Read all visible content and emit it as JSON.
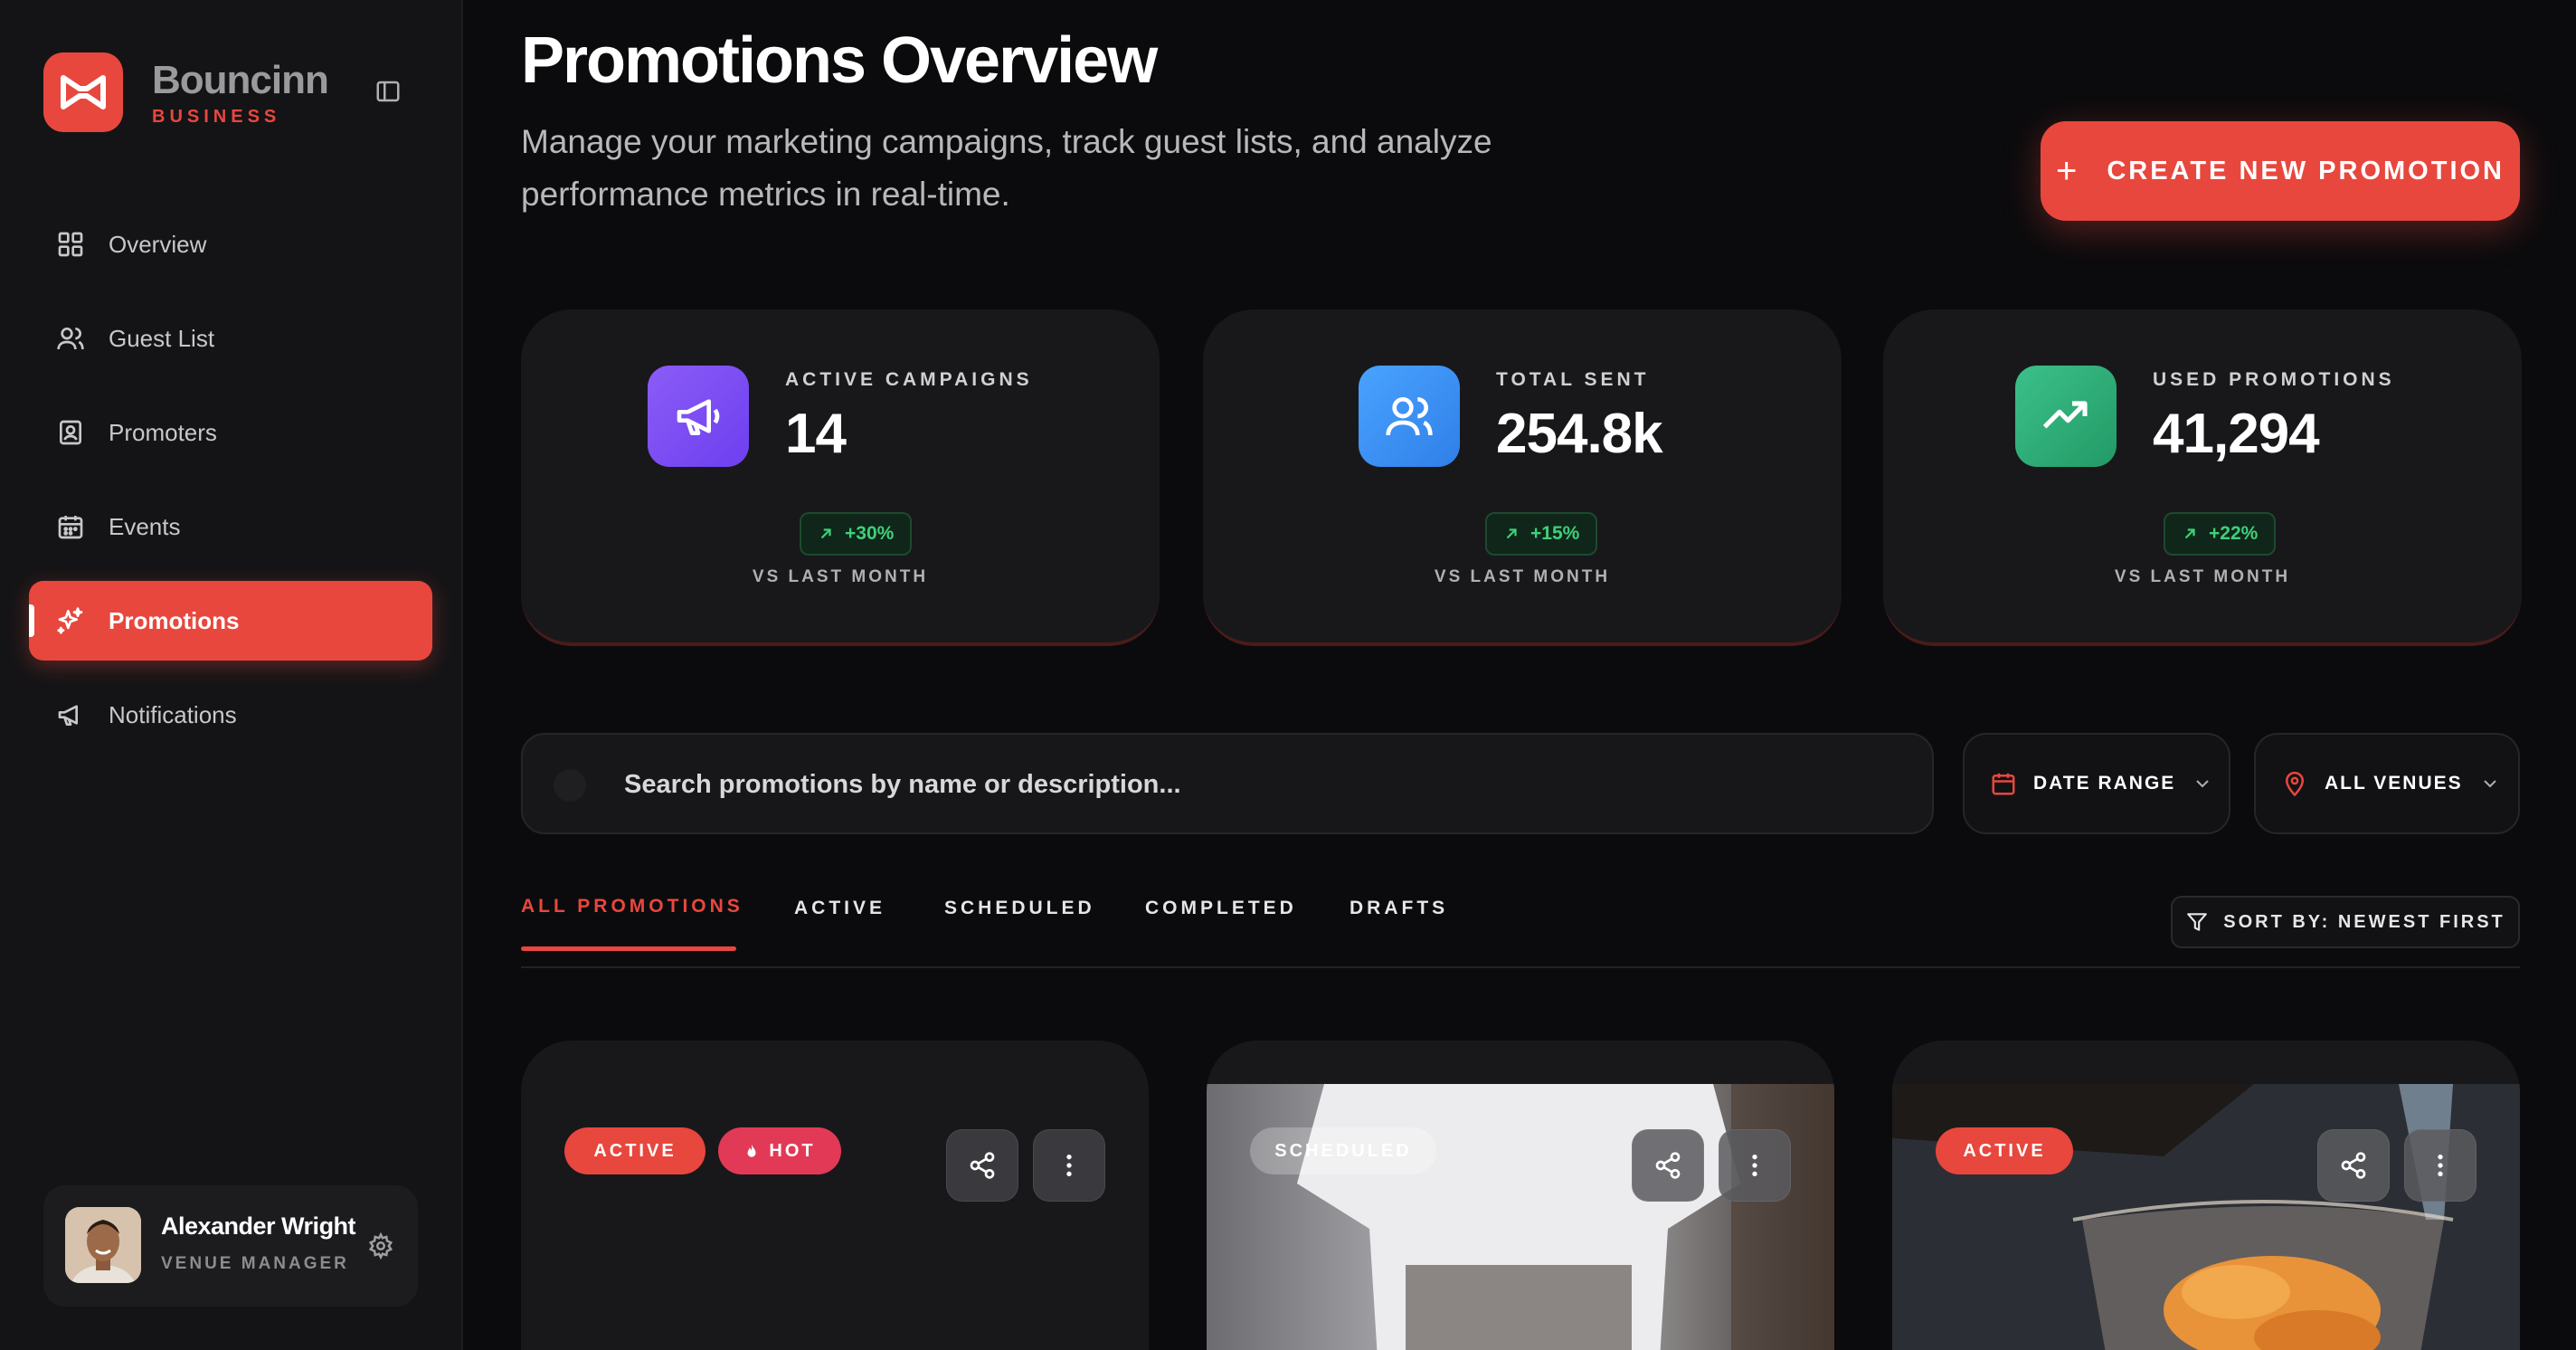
{
  "brand": {
    "name": "Bouncinn",
    "subtitle": "BUSINESS"
  },
  "sidebar": {
    "items": [
      {
        "label": "Overview",
        "icon": "grid-icon"
      },
      {
        "label": "Guest List",
        "icon": "users-icon"
      },
      {
        "label": "Promoters",
        "icon": "id-badge-icon"
      },
      {
        "label": "Events",
        "icon": "calendar-icon"
      },
      {
        "label": "Promotions",
        "icon": "sparkles-icon",
        "active": true
      },
      {
        "label": "Notifications",
        "icon": "megaphone-icon"
      }
    ]
  },
  "user": {
    "name": "Alexander Wright",
    "role": "VENUE MANAGER"
  },
  "header": {
    "title": "Promotions Overview",
    "description": "Manage your marketing campaigns, track guest lists, and analyze performance metrics in real-time.",
    "create_label": "CREATE NEW PROMOTION"
  },
  "stats": [
    {
      "label": "ACTIVE CAMPAIGNS",
      "value": "14",
      "change": "+30%",
      "footnote": "VS LAST MONTH",
      "icon": "megaphone-icon",
      "color": "#7c4dff"
    },
    {
      "label": "TOTAL SENT",
      "value": "254.8k",
      "change": "+15%",
      "footnote": "VS LAST MONTH",
      "icon": "users-icon",
      "color": "#3b8ff0"
    },
    {
      "label": "USED PROMOTIONS",
      "value": "41,294",
      "change": "+22%",
      "footnote": "VS LAST MONTH",
      "icon": "trending-up-icon",
      "color": "#2fa673"
    }
  ],
  "search": {
    "placeholder": "Search promotions by name or description..."
  },
  "filters": {
    "date_range": "DATE RANGE",
    "venues": "ALL VENUES"
  },
  "tabs": [
    "ALL PROMOTIONS",
    "ACTIVE",
    "SCHEDULED",
    "COMPLETED",
    "DRAFTS"
  ],
  "sort": {
    "label": "SORT BY: NEWEST FIRST"
  },
  "promotions": [
    {
      "status": "ACTIVE",
      "tag": "HOT"
    },
    {
      "status": "SCHEDULED"
    },
    {
      "status": "ACTIVE"
    }
  ],
  "colors": {
    "accent": "#e8473e",
    "background": "#0b0b0d",
    "success": "#3fd07a"
  }
}
